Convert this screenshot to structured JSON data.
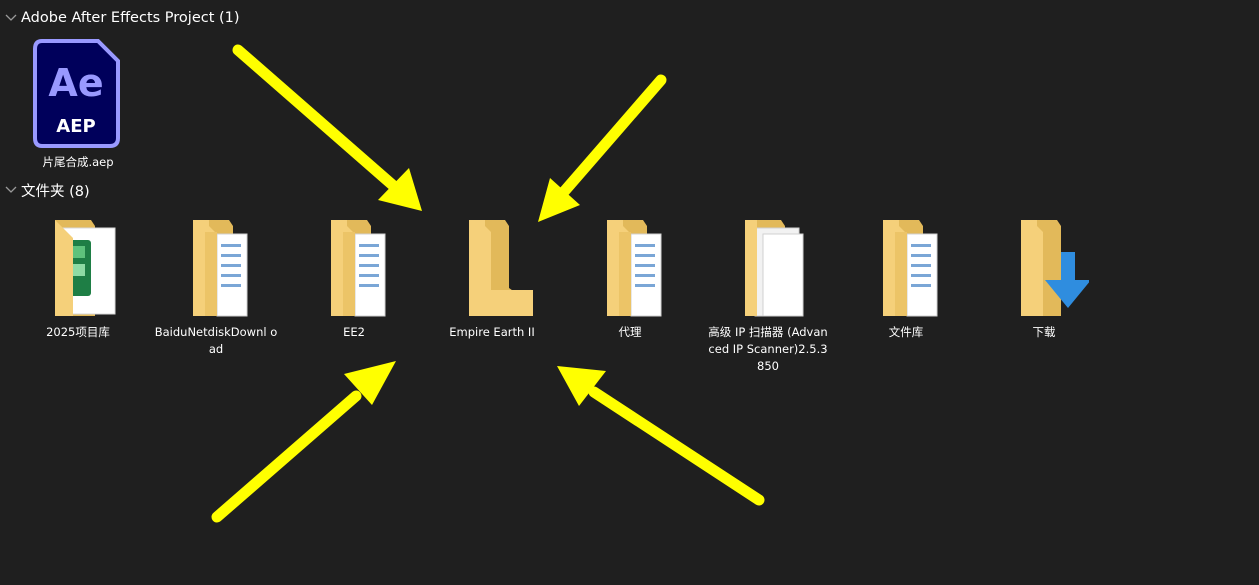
{
  "groups": [
    {
      "title": "Adobe After Effects Project (1)"
    },
    {
      "title": "文件夹 (8)"
    }
  ],
  "project_file": {
    "name": "片尾合成.aep",
    "icon_glyph": "Ae",
    "icon_subtext": "AEP"
  },
  "folders": [
    {
      "name": "2025项目库"
    },
    {
      "name": "BaiduNetdiskDownl oad"
    },
    {
      "name": "EE2"
    },
    {
      "name": "Empire Earth II"
    },
    {
      "name": "代理"
    },
    {
      "name": "高级 IP 扫描器 (Advanced IP Scanner)2.5.3850"
    },
    {
      "name": "文件库"
    },
    {
      "name": "下载"
    }
  ],
  "colors": {
    "background": "#1f1f1f",
    "folder": "#f5d07a",
    "folder_dark": "#e2b95a",
    "ae_bg": "#00005b",
    "ae_border": "#9999ff",
    "annotation_arrow": "#ffff00",
    "download_arrow": "#2f8ddf"
  }
}
